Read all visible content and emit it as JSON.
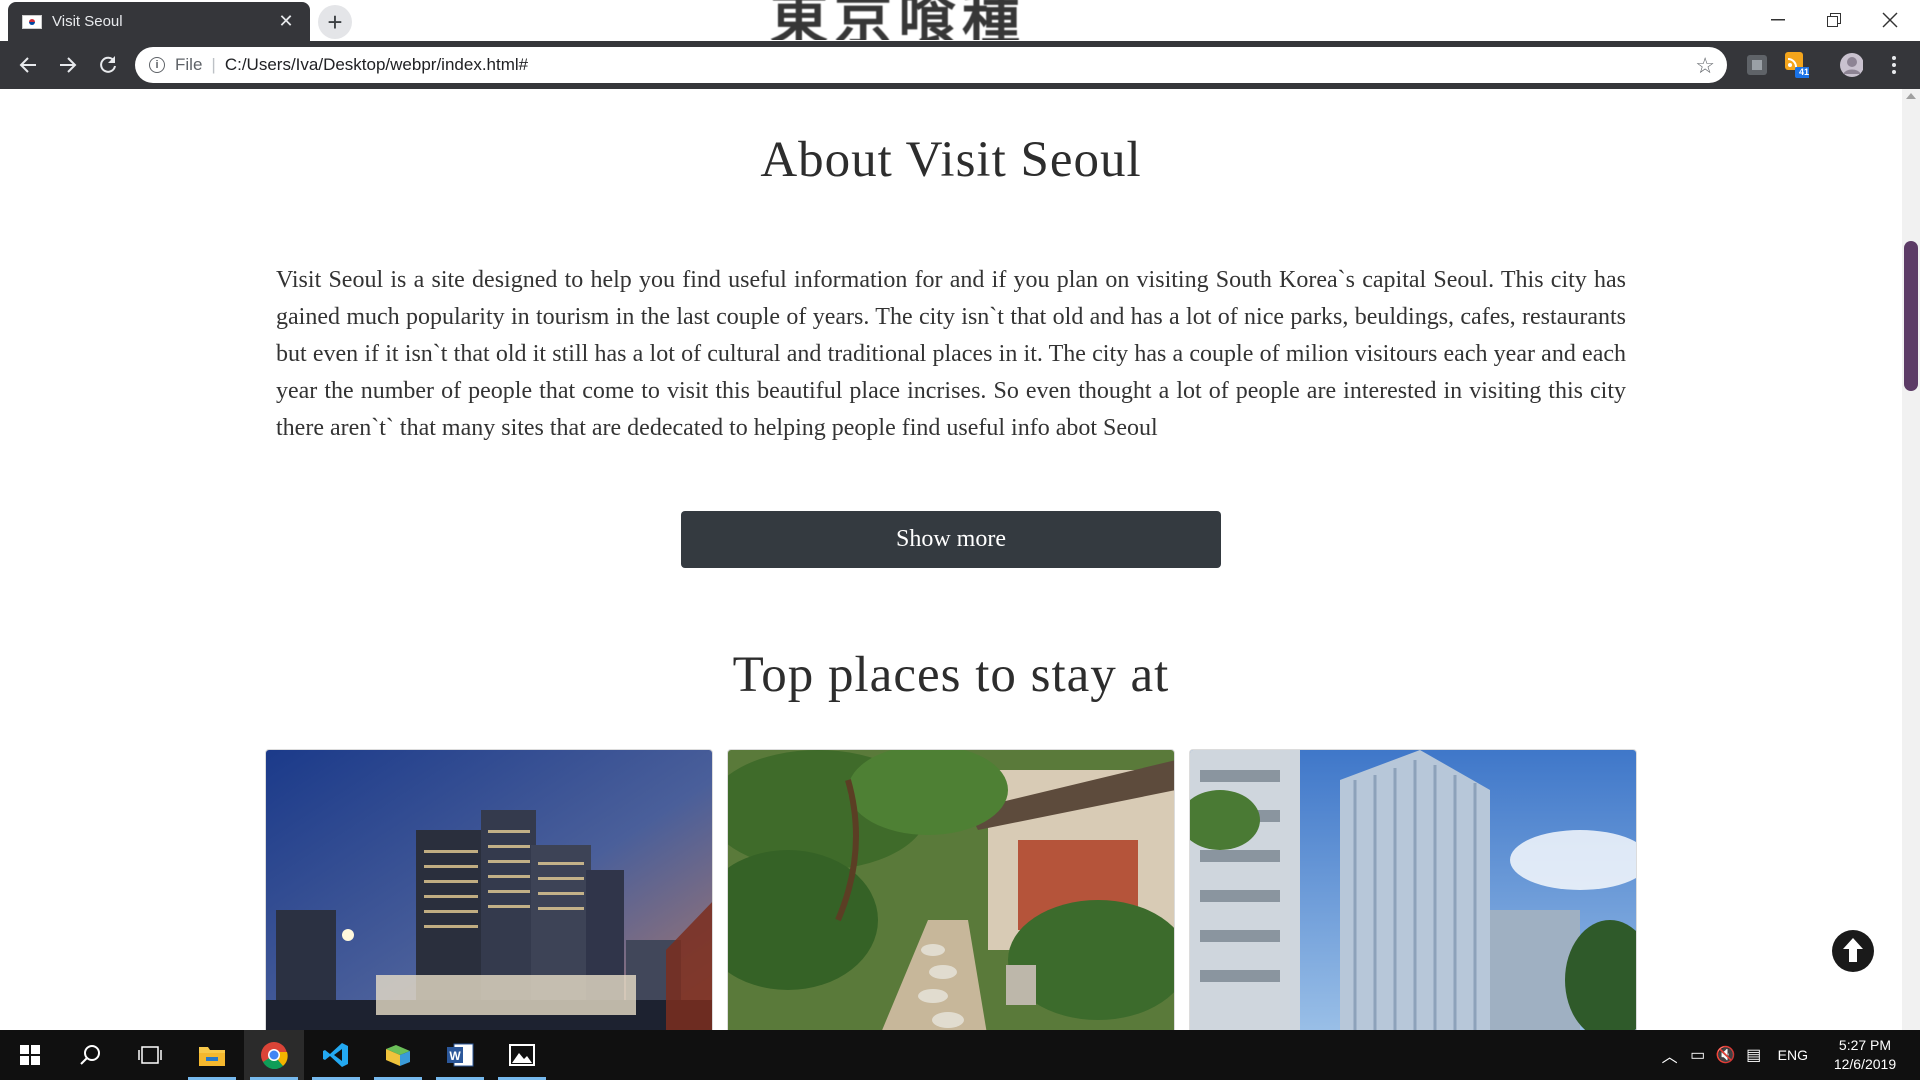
{
  "browser": {
    "tab_title": "Visit Seoul",
    "tab_close": "✕",
    "new_tab": "+",
    "banner_text": "東京喰種",
    "url_scheme": "File",
    "url_path": "C:/Users/Iva/Desktop/webpr/index.html#",
    "extension_badge": "41"
  },
  "page": {
    "about_title": "About Visit Seoul",
    "about_text": "Visit Seoul is a site designed to help you find useful information for and if you plan on visiting South Korea`s capital Seoul. This city has gained much popularity in tourism in the last couple of years. The city isn`t that old and has a lot of nice parks, beuldings, cafes, restaurants but even if it isn`t that old it still has a lot of cultural and traditional places in it. The city has a couple of milion visitours each year and each year the number of people that come to visit this beautiful place incrises. So even thought a lot of people are interested in visiting this city there aren`t` that many sites that are dedecated to helping people find useful info abot Seoul",
    "show_more_label": "Show more",
    "places_title": "Top places to stay at",
    "cards": [
      {
        "image": "hotel-tower-night"
      },
      {
        "image": "hanok-garden"
      },
      {
        "image": "glass-office-building"
      }
    ]
  },
  "taskbar": {
    "language": "ENG",
    "time": "5:27 PM",
    "date": "12/6/2019"
  },
  "colors": {
    "toolbar": "#35363a",
    "button": "#343a40",
    "scroll_thumb": "#5c3b66",
    "taskbar": "#101010"
  }
}
